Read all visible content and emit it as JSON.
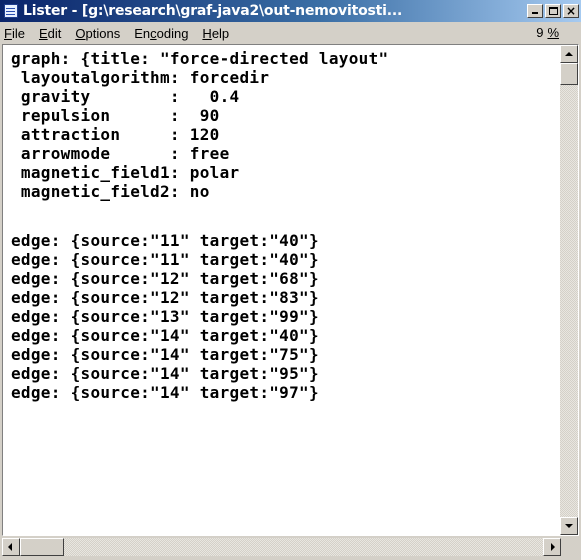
{
  "window": {
    "title": "Lister - [g:\\research\\graf-java2\\out-nemovitosti...",
    "title_icon": "lister-document-icon",
    "controls": {
      "minimize": "minimize-icon",
      "maximize": "maximize-icon",
      "close_label": "×"
    }
  },
  "menu": {
    "items": [
      {
        "key": "File",
        "underline": "F",
        "rest": "ile"
      },
      {
        "key": "Edit",
        "underline": "E",
        "rest": "dit"
      },
      {
        "key": "Options",
        "underline": "O",
        "rest": "ptions"
      },
      {
        "key": "Encoding",
        "pre": "En",
        "underline": "c",
        "rest": "oding"
      },
      {
        "key": "Help",
        "underline": "H",
        "rest": "elp"
      }
    ],
    "percent_value": "9",
    "percent_symbol": "%"
  },
  "content": {
    "lines": [
      "graph: {title: \"force-directed layout\"",
      " layoutalgorithm: forcedir",
      " gravity        :   0.4",
      " repulsion      :  90",
      " attraction     : 120",
      " arrowmode      : free",
      " magnetic_field1: polar",
      " magnetic_field2: no",
      "",
      "edge: {source:\"11\" target:\"40\"}",
      "edge: {source:\"11\" target:\"40\"}",
      "edge: {source:\"12\" target:\"68\"}",
      "edge: {source:\"12\" target:\"83\"}",
      "edge: {source:\"13\" target:\"99\"}",
      "edge: {source:\"14\" target:\"40\"}",
      "edge: {source:\"14\" target:\"75\"}",
      "edge: {source:\"14\" target:\"95\"}",
      "edge: {source:\"14\" target:\"97\"}"
    ]
  }
}
